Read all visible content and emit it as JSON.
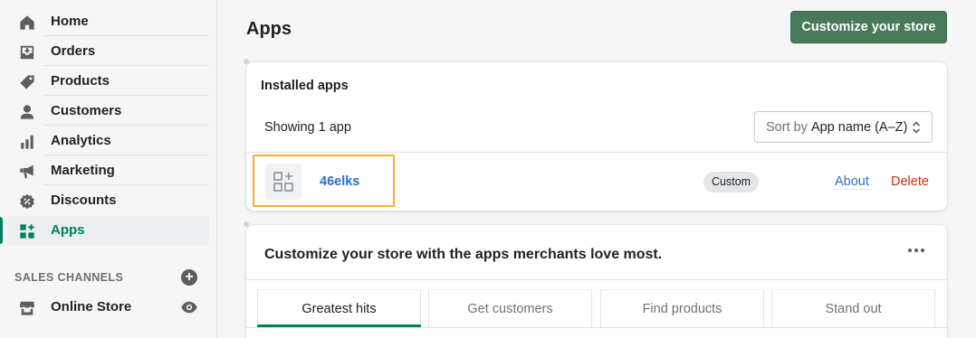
{
  "sidebar": {
    "items": [
      {
        "label": "Home",
        "icon": "home-icon"
      },
      {
        "label": "Orders",
        "icon": "orders-icon"
      },
      {
        "label": "Products",
        "icon": "tag-icon"
      },
      {
        "label": "Customers",
        "icon": "person-icon"
      },
      {
        "label": "Analytics",
        "icon": "bar-chart-icon"
      },
      {
        "label": "Marketing",
        "icon": "megaphone-icon"
      },
      {
        "label": "Discounts",
        "icon": "discount-icon"
      },
      {
        "label": "Apps",
        "icon": "apps-icon",
        "active": true
      }
    ],
    "sales_channels_title": "SALES CHANNELS",
    "online_store_label": "Online Store"
  },
  "header": {
    "title": "Apps",
    "customize_button": "Customize your store"
  },
  "installed": {
    "title": "Installed apps",
    "showing_text": "Showing 1 app",
    "sort_prefix": "Sort by",
    "sort_value": "App name (A–Z)",
    "apps": [
      {
        "name": "46elks",
        "badge": "Custom",
        "about_label": "About",
        "delete_label": "Delete"
      }
    ]
  },
  "recommend": {
    "title": "Customize your store with the apps merchants love most.",
    "tabs": [
      "Greatest hits",
      "Get customers",
      "Find products",
      "Stand out"
    ],
    "selected_tab": "Greatest hits"
  },
  "colors": {
    "accent": "#008060",
    "primary_button": "#47795a",
    "link": "#2c6ecb",
    "danger": "#d72c0d",
    "highlight_border": "#f2b132"
  }
}
